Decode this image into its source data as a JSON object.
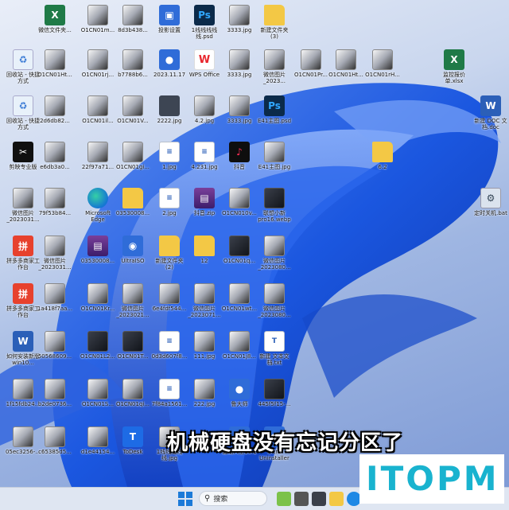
{
  "subtitle": "机械硬盘没有忘记分区了",
  "logo": "ITOPM",
  "taskbar": {
    "search_placeholder": "搜索"
  },
  "colors": {
    "wallpaper_blue": "#1750d6",
    "logo_cyan": "#19b3cf"
  },
  "icons": [
    {
      "label": "微信文件夹...",
      "icon": "xls-icon"
    },
    {
      "label": "O1CN01m...",
      "icon": "image-file-icon"
    },
    {
      "label": "8d3b438...",
      "icon": "image-file-icon"
    },
    {
      "label": "投影设置",
      "icon": "screen-settings-icon"
    },
    {
      "label": "1线线线线线.psd",
      "icon": "photoshop-icon"
    },
    {
      "label": "3333.jpg",
      "icon": "image-file-icon"
    },
    {
      "label": "新建文件夹 (3)",
      "icon": "folder-icon"
    },
    {
      "label": "回收站 - 快捷方式",
      "icon": "recycle-bin-icon"
    },
    {
      "label": "O1CN01Ht...",
      "icon": "image-file-icon"
    },
    {
      "label": "O1CN01rj...",
      "icon": "image-file-icon"
    },
    {
      "label": "b7788b6...",
      "icon": "image-file-icon"
    },
    {
      "label": "2023.11.17",
      "icon": "app-icon"
    },
    {
      "label": "WPS Office",
      "icon": "wps-icon"
    },
    {
      "label": "3333.jpg",
      "icon": "image-file-icon"
    },
    {
      "label": "微信图片_2023...",
      "icon": "image-file-icon"
    },
    {
      "label": "O1CN01Pr...",
      "icon": "image-file-icon"
    },
    {
      "label": "O1CN01Ht...",
      "icon": "image-file-icon"
    },
    {
      "label": "O1CN01rH...",
      "icon": "image-file-icon"
    },
    {
      "label": "监控报价单.xlsx",
      "icon": "xls-icon"
    },
    {
      "label": "回收站 - 快捷方式",
      "icon": "recycle-bin-icon"
    },
    {
      "label": "2d6db82...",
      "icon": "image-file-icon"
    },
    {
      "label": "O1CN01il...",
      "icon": "image-file-icon"
    },
    {
      "label": "O1CN01V...",
      "icon": "image-file-icon"
    },
    {
      "label": "2222.jpg",
      "icon": "pc-image-icon"
    },
    {
      "label": "4.2.jpg",
      "icon": "image-file-icon"
    },
    {
      "label": "3333.jpg",
      "icon": "image-file-icon"
    },
    {
      "label": "E41主图.psd",
      "icon": "photoshop-icon"
    },
    {
      "label": "新建 DOC 文档.doc",
      "icon": "word-icon"
    },
    {
      "label": "剪映专业版",
      "icon": "capcut-icon"
    },
    {
      "label": "e6db3a0...",
      "icon": "image-file-icon"
    },
    {
      "label": "22f97a71...",
      "icon": "image-file-icon"
    },
    {
      "label": "O1CN01gi...",
      "icon": "image-file-icon"
    },
    {
      "label": "1.jpg",
      "icon": "doc-image-icon"
    },
    {
      "label": "4.231.jpg",
      "icon": "doc-image-icon"
    },
    {
      "label": "抖音",
      "icon": "tiktok-icon"
    },
    {
      "label": "E41主图.jpg",
      "icon": "image-file-icon"
    },
    {
      "label": "6.2",
      "icon": "folder-icon"
    },
    {
      "label": "微信图片_2023031...",
      "icon": "image-file-icon"
    },
    {
      "label": "79f53b84...",
      "icon": "image-file-icon"
    },
    {
      "label": "Microsoft Edge",
      "icon": "edge-icon"
    },
    {
      "label": "03530008...",
      "icon": "folder-icon"
    },
    {
      "label": "2.jpg",
      "icon": "doc-image-icon"
    },
    {
      "label": "抖音.zip",
      "icon": "rar-icon"
    },
    {
      "label": "O1CN010v...",
      "icon": "image-file-icon"
    },
    {
      "label": "联想小新pro16.webp",
      "icon": "laptop-image-icon"
    },
    {
      "label": "定时关机.bat",
      "icon": "gear-file-icon"
    },
    {
      "label": "拼多多商家工作台",
      "icon": "pdd-icon"
    },
    {
      "label": "微信图片_2023031...",
      "icon": "image-file-icon"
    },
    {
      "label": "03530008...",
      "icon": "rar-icon"
    },
    {
      "label": "UltraISO",
      "icon": "disc-icon"
    },
    {
      "label": "新建文件夹 (2)",
      "icon": "folder-icon"
    },
    {
      "label": "12",
      "icon": "folder-icon"
    },
    {
      "label": "O1CN01q...",
      "icon": "dark-image-icon"
    },
    {
      "label": "微信图片_2023080...",
      "icon": "image-file-icon"
    },
    {
      "label": "拼多多商家工作台",
      "icon": "pdd-icon"
    },
    {
      "label": "1a418f7aa...",
      "icon": "image-file-icon"
    },
    {
      "label": "O1CN01Kr...",
      "icon": "image-file-icon"
    },
    {
      "label": "微信图片_2023021...",
      "icon": "image-file-icon"
    },
    {
      "label": "6e4fdf544...",
      "icon": "image-file-icon"
    },
    {
      "label": "微信图片_2023071...",
      "icon": "image-file-icon"
    },
    {
      "label": "O1CN01wt...",
      "icon": "image-file-icon"
    },
    {
      "label": "微信图片_2023080...",
      "icon": "image-file-icon"
    },
    {
      "label": "如何安装新版win10...",
      "icon": "word-icon"
    },
    {
      "label": "50568609...",
      "icon": "image-file-icon"
    },
    {
      "label": "O1CN01L2...",
      "icon": "dark-image-icon"
    },
    {
      "label": "O1CN01T...",
      "icon": "dark-image-icon"
    },
    {
      "label": "0d3d607f8...",
      "icon": "doc-image-icon"
    },
    {
      "label": "111.jpg",
      "icon": "image-file-icon"
    },
    {
      "label": "O1CN01j8...",
      "icon": "image-file-icon"
    },
    {
      "label": "新建 文本文档.txt",
      "icon": "text-file-icon"
    },
    {
      "label": "1f15fdb24...",
      "icon": "image-file-icon"
    },
    {
      "label": "b2de0736...",
      "icon": "image-file-icon"
    },
    {
      "label": "O1CN01S...",
      "icon": "image-file-icon"
    },
    {
      "label": "O1CN01qi...",
      "icon": "image-file-icon"
    },
    {
      "label": "7f84a1561...",
      "icon": "doc-image-icon"
    },
    {
      "label": "222.jpg",
      "icon": "image-file-icon"
    },
    {
      "label": "鲁大师",
      "icon": "app-icon"
    },
    {
      "label": "445f5f15-...",
      "icon": "dark-image-icon"
    },
    {
      "label": "05ec3256-...",
      "icon": "image-file-icon"
    },
    {
      "label": "c65385d5...",
      "icon": "image-file-icon"
    },
    {
      "label": "d1e44154...",
      "icon": "image-file-icon"
    },
    {
      "label": "ToDesk",
      "icon": "todesk-icon"
    },
    {
      "label": "1线线线线线.jpg",
      "icon": "image-file-icon"
    },
    {
      "label": "驱动人生10.1",
      "icon": "app-icon"
    },
    {
      "label": "Ultra Uninstaller",
      "icon": "app-icon"
    }
  ]
}
